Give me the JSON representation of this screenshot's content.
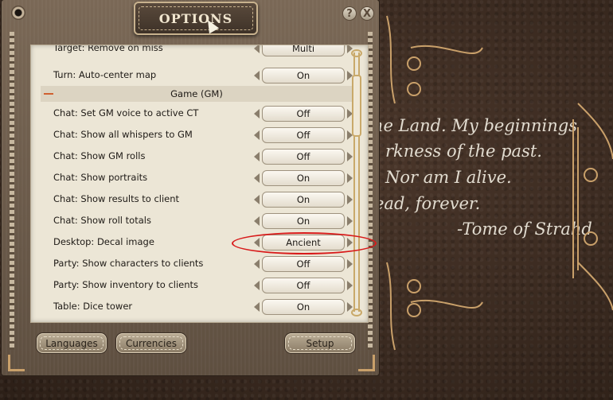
{
  "window": {
    "title": "OPTIONS",
    "help_label": "?",
    "close_label": "X"
  },
  "background_quote": {
    "line1": "he Land.  My  beginnings",
    "line2": "rkness of the past.",
    "line3": "Nor am I alive.",
    "line4": "ead, forever.",
    "line5": "-Tome of Strahd"
  },
  "options": {
    "rows": [
      {
        "label": "Target: Remove on miss",
        "value": "Multi"
      },
      {
        "label": "Turn: Auto-center map",
        "value": "On"
      }
    ],
    "group": "Game (GM)",
    "group_rows": [
      {
        "label": "Chat: Set GM voice to active CT",
        "value": "Off"
      },
      {
        "label": "Chat: Show all whispers to GM",
        "value": "Off"
      },
      {
        "label": "Chat: Show GM rolls",
        "value": "Off"
      },
      {
        "label": "Chat: Show portraits",
        "value": "On"
      },
      {
        "label": "Chat: Show results to client",
        "value": "On"
      },
      {
        "label": "Chat: Show roll totals",
        "value": "On"
      },
      {
        "label": "Desktop: Decal image",
        "value": "Ancient"
      },
      {
        "label": "Party: Show characters to clients",
        "value": "Off"
      },
      {
        "label": "Party: Show inventory to clients",
        "value": "Off"
      },
      {
        "label": "Table: Dice tower",
        "value": "On"
      }
    ]
  },
  "buttons": {
    "languages": "Languages",
    "currencies": "Currencies",
    "setup": "Setup"
  },
  "colors": {
    "accent": "#c9a06a",
    "highlight_ellipse": "#d81a1a",
    "group_dash": "#d06030"
  }
}
